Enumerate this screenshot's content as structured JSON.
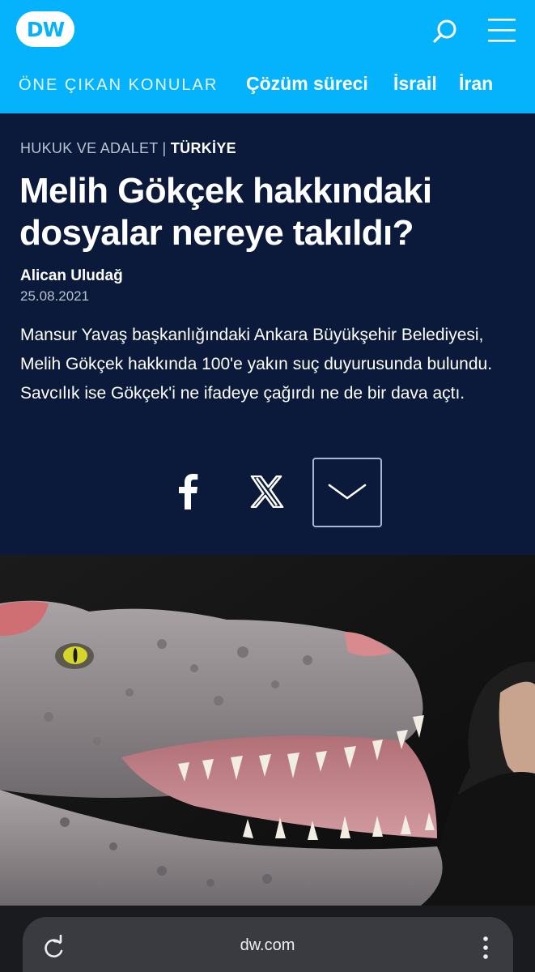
{
  "header": {
    "logo_text": "DW",
    "brand_color": "#05b2fc",
    "search_icon": "search-icon",
    "menu_icon": "hamburger-menu-icon",
    "nav_label": "ÖNE ÇIKAN KONULAR",
    "nav_items": [
      "Çözüm süreci",
      "İsrail",
      "İran"
    ]
  },
  "article": {
    "kicker_category": "HUKUK VE ADALET",
    "kicker_separator": "|",
    "kicker_country": "TÜRKİYE",
    "title": "Melih Gökçek hakkındaki dosyalar nereye takıldı?",
    "author": "Alican Uludağ",
    "date": "25.08.2021",
    "lead": "Mansur Yavaş başkanlığındaki Ankara Büyükşehir Belediyesi, Melih Gökçek hakkında 100'e yakın suç duyurusunda bulundu. Savcılık ise Gökçek'i ne ifadeye çağırdı ne de bir dava açtı.",
    "background_color": "#0b1a3a"
  },
  "share": {
    "facebook_icon": "facebook-icon",
    "x_icon": "x-twitter-icon",
    "more_icon": "chevron-down-icon"
  },
  "hero": {
    "image_description_icon": "dinosaur-photo"
  },
  "browser": {
    "url": "dw.com",
    "reload_icon": "reload-icon",
    "menu_icon": "more-vertical-icon"
  }
}
